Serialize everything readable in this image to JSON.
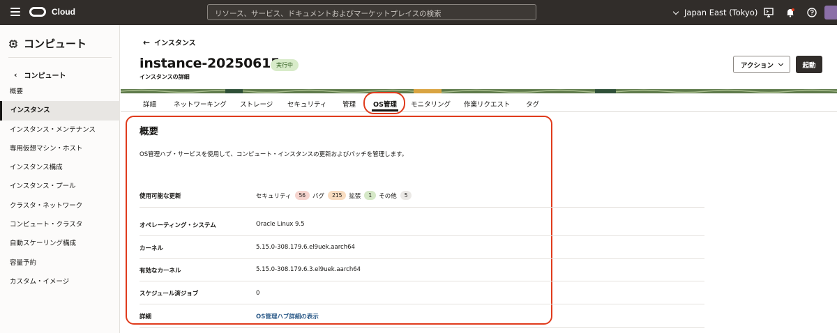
{
  "topbar": {
    "brand": "Cloud",
    "search_placeholder": "リソース、サービス、ドキュメントおよびマーケットプレイスの検索",
    "region": "Japan East (Tokyo)"
  },
  "sidebar": {
    "title": "コンピュート",
    "back_label": "コンピュート",
    "items": [
      {
        "label": "概要"
      },
      {
        "label": "インスタンス"
      },
      {
        "label": "インスタンス・メンテナンス"
      },
      {
        "label": "専用仮想マシン・ホスト"
      },
      {
        "label": "インスタンス構成"
      },
      {
        "label": "インスタンス・プール"
      },
      {
        "label": "クラスタ・ネットワーク"
      },
      {
        "label": "コンピュート・クラスタ"
      },
      {
        "label": "自動スケーリング構成"
      },
      {
        "label": "容量予約"
      },
      {
        "label": "カスタム・イメージ"
      }
    ]
  },
  "header": {
    "back_link": "インスタンス",
    "title": "instance-20250615",
    "status": "実行中",
    "subtitle": "インスタンスの詳細",
    "action_button": "アクション",
    "start_button": "起動"
  },
  "tabs": [
    "詳細",
    "ネットワーキング",
    "ストレージ",
    "セキュリティ",
    "管理",
    "OS管理",
    "モニタリング",
    "作業リクエスト",
    "タグ"
  ],
  "overview": {
    "title": "概要",
    "description": "OS管理ハブ・サービスを使用して、コンピュート・インスタンスの更新およびパッチを管理します。",
    "updates_label": "使用可能な更新",
    "updates": [
      {
        "label": "セキュリティ",
        "count": "56",
        "color": "#f6d4ce"
      },
      {
        "label": "バグ",
        "count": "215",
        "color": "#f8dcc0"
      },
      {
        "label": "拡張",
        "count": "1",
        "color": "#d5e8c7"
      },
      {
        "label": "その他",
        "count": "5",
        "color": "#ebe9e6"
      }
    ],
    "rows": [
      {
        "label": "オペレーティング・システム",
        "value": "Oracle Linux 9.5"
      },
      {
        "label": "カーネル",
        "value": "5.15.0-308.179.6.el9uek.aarch64"
      },
      {
        "label": "有効なカーネル",
        "value": "5.15.0-308.179.6.3.el9uek.aarch64"
      },
      {
        "label": "スケジュール済ジョブ",
        "value": "0"
      }
    ],
    "details_label": "詳細",
    "details_link": "OS管理ハブ詳細の表示"
  },
  "colors": {
    "topbar": "#312d2a",
    "highlight": "#e03b1c",
    "link": "#2e5c8a",
    "status_bg": "#d8ebc9"
  }
}
